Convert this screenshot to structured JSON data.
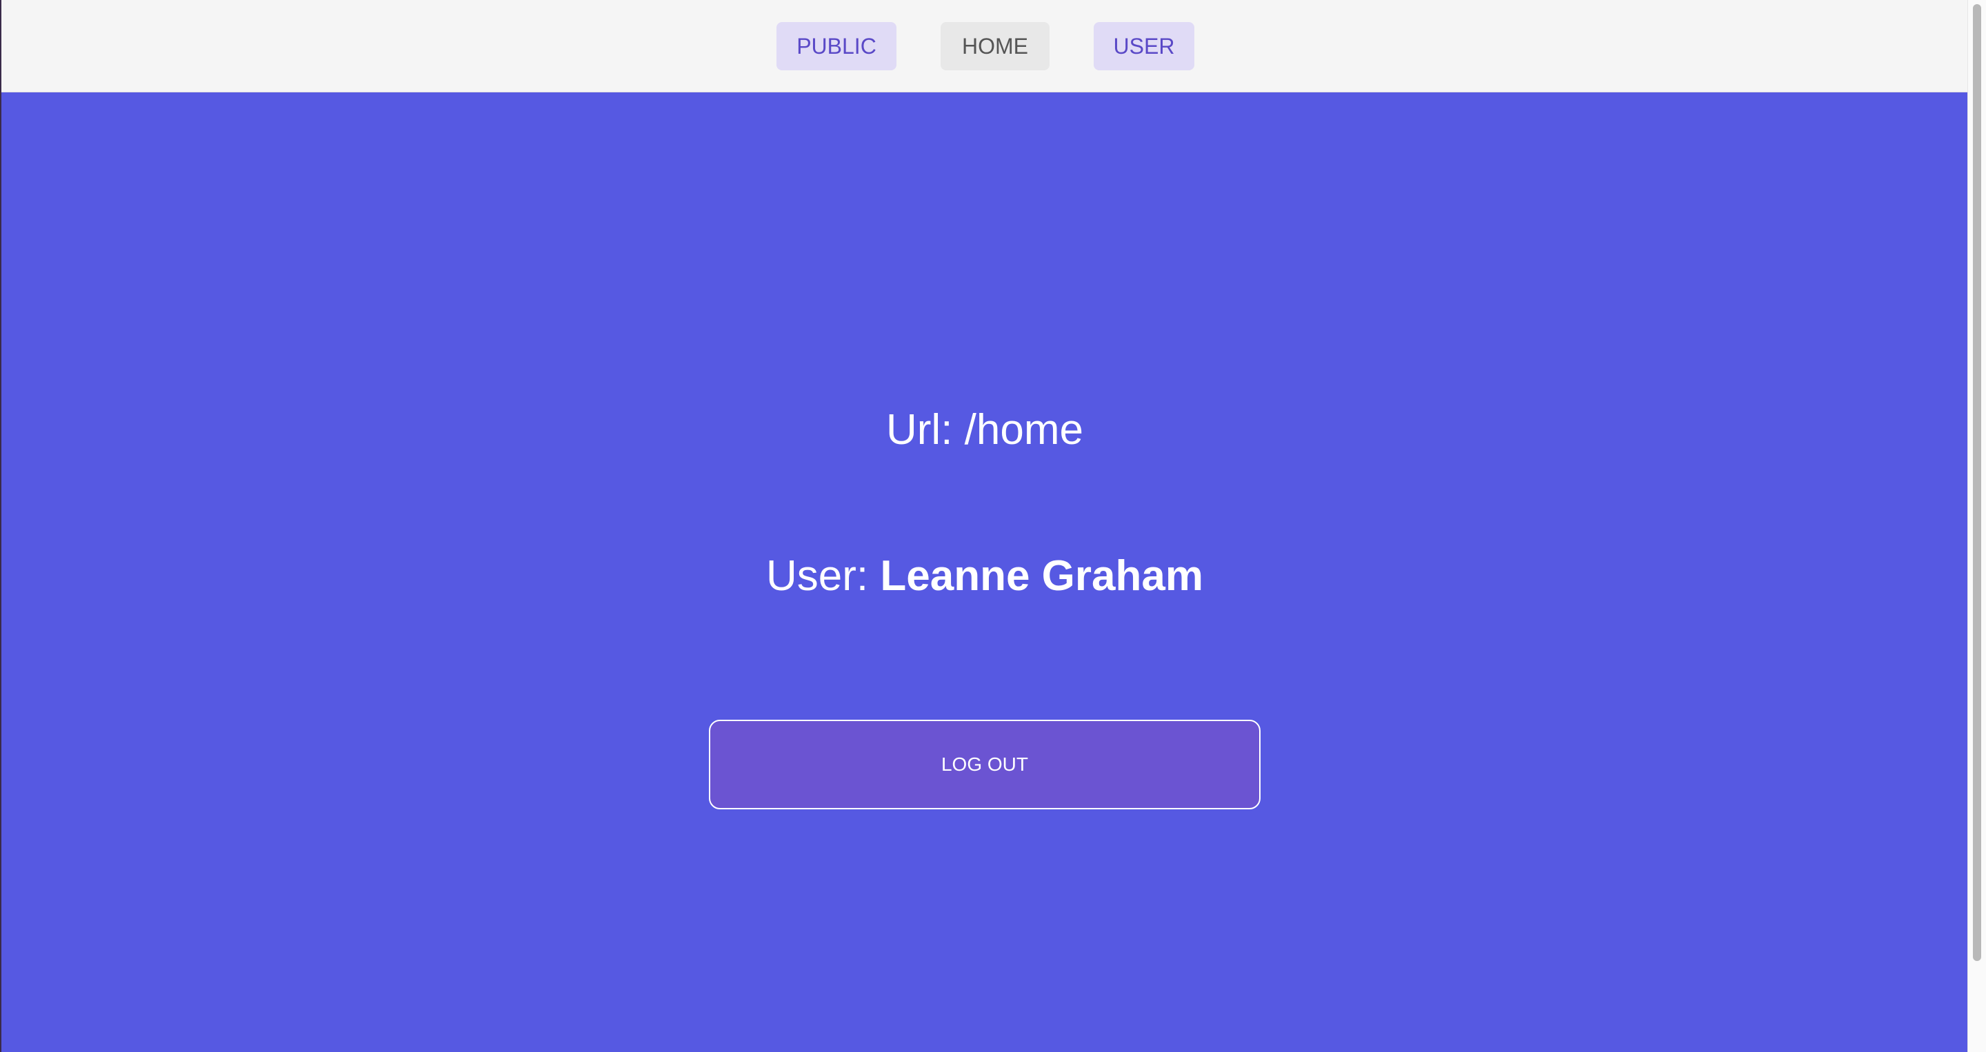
{
  "nav": {
    "items": [
      {
        "label": "PUBLIC"
      },
      {
        "label": "HOME"
      },
      {
        "label": "USER"
      }
    ]
  },
  "main": {
    "url_label": "Url: /home",
    "user_prefix": "User: ",
    "user_name": "Leanne Graham",
    "logout_label": "LOG OUT"
  },
  "colors": {
    "main_background": "#5659e2",
    "navbar_background": "#f5f5f5",
    "nav_accent_background": "#e0dbf6",
    "nav_accent_text": "#5a49c7",
    "logout_background": "#6b54d2"
  }
}
